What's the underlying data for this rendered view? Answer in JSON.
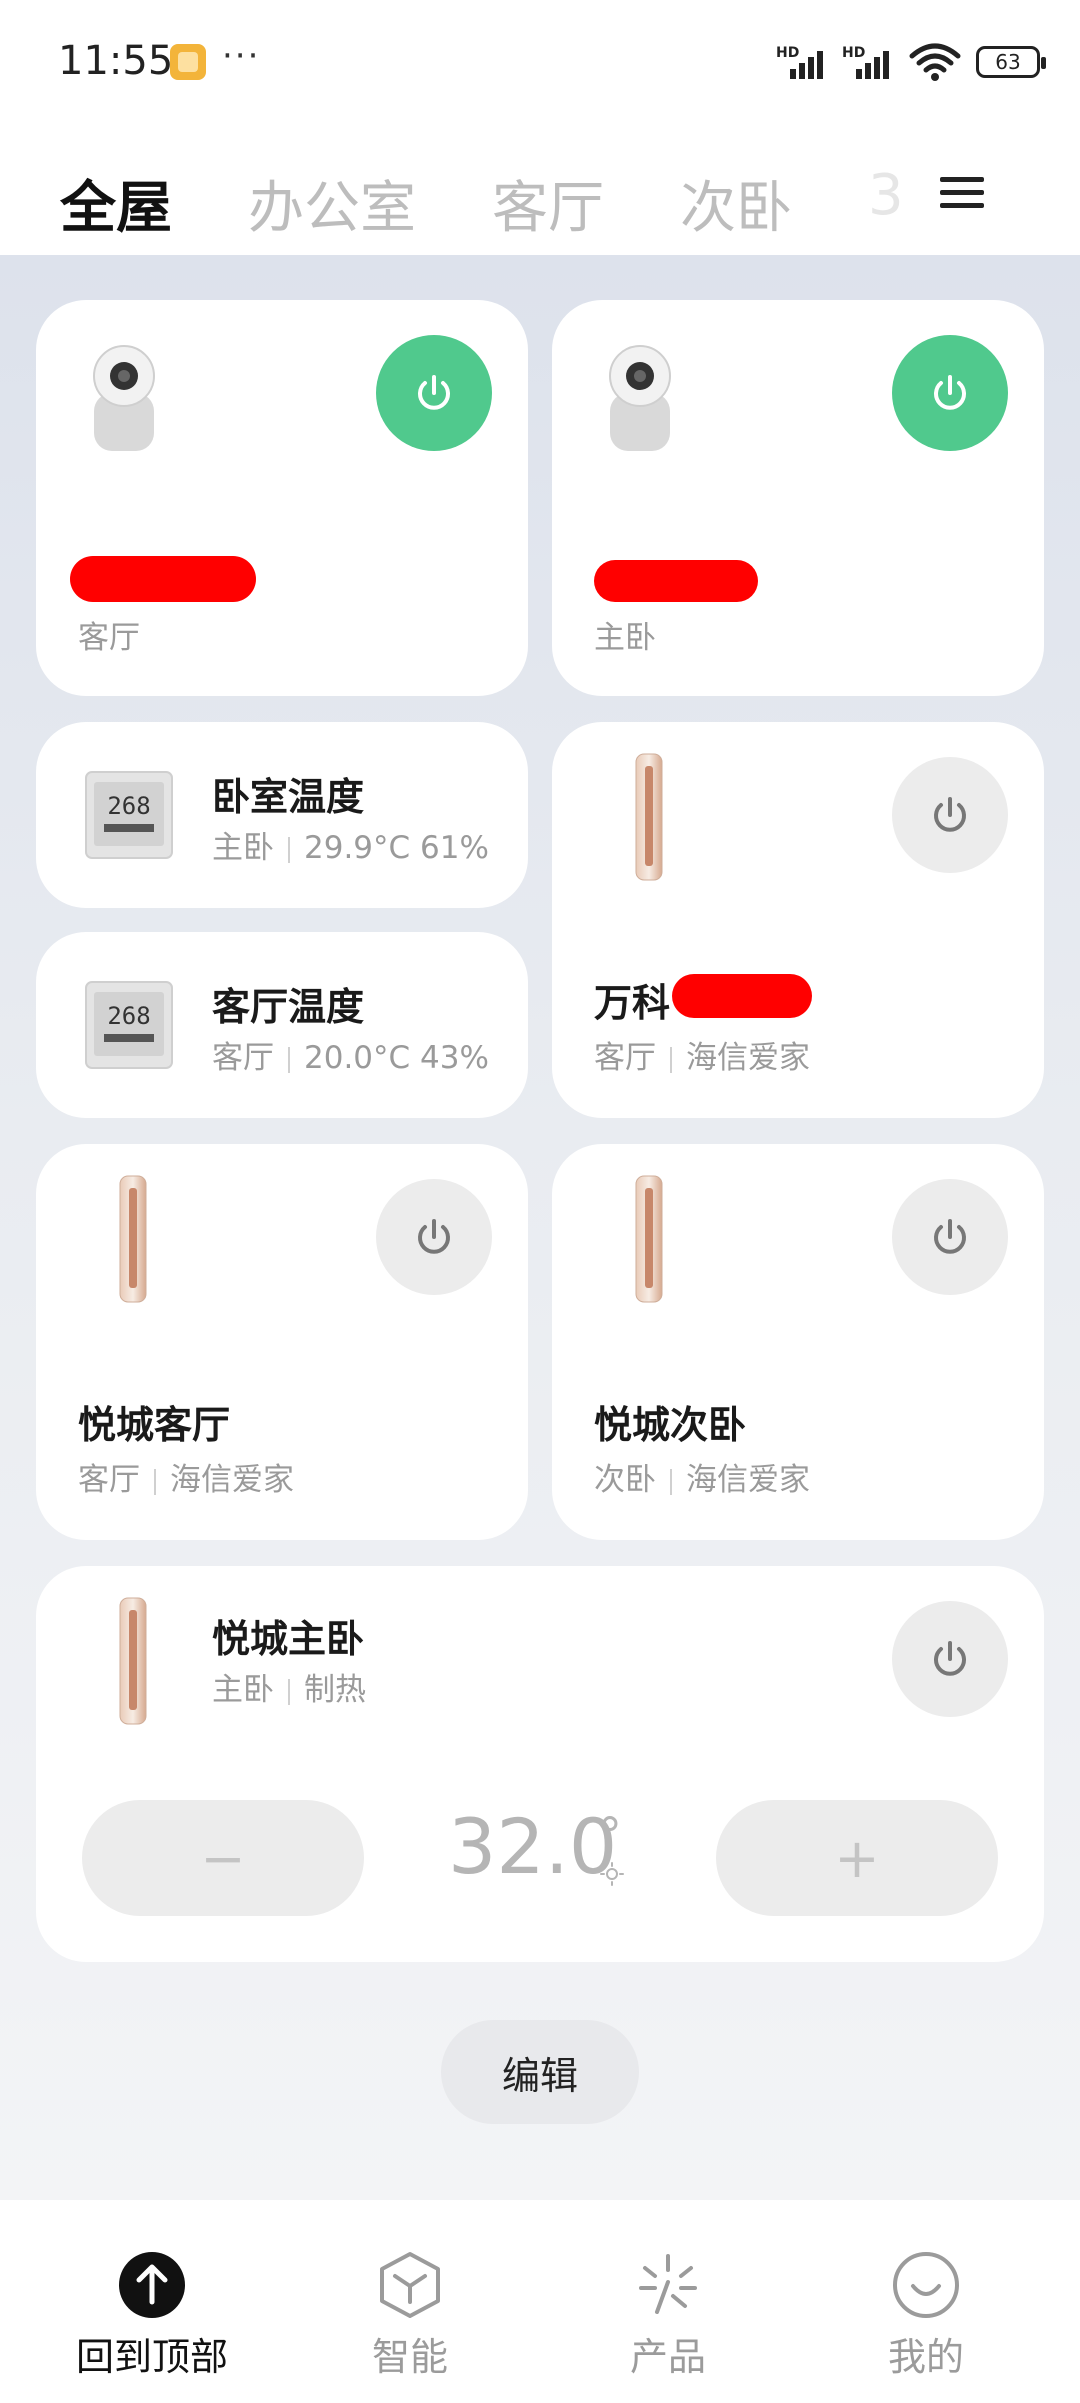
{
  "status_bar": {
    "time": "11:55",
    "more": "···",
    "signal1_badge": "HD",
    "signal2_badge": "HD",
    "battery": "63"
  },
  "tabs": [
    {
      "label": "全屋",
      "active": true
    },
    {
      "label": "办公室"
    },
    {
      "label": "客厅"
    },
    {
      "label": "次卧"
    },
    {
      "label": "3"
    }
  ],
  "cards": {
    "camera1": {
      "room": "客厅",
      "power": "on"
    },
    "camera2": {
      "room": "主卧",
      "power": "on"
    },
    "sensor1": {
      "name": "卧室温度",
      "room": "主卧",
      "reading": "29.9°C 61%",
      "display": "268"
    },
    "sensor2": {
      "name": "客厅温度",
      "room": "客厅",
      "reading": "20.0°C 43%",
      "display": "268"
    },
    "ac_vanke": {
      "name": "万科",
      "room": "客厅",
      "brand": "海信爱家"
    },
    "ac_living": {
      "name": "悦城客厅",
      "room": "客厅",
      "brand": "海信爱家"
    },
    "ac_second": {
      "name": "悦城次卧",
      "room": "次卧",
      "brand": "海信爱家"
    },
    "ac_master": {
      "name": "悦城主卧",
      "room": "主卧",
      "mode": "制热",
      "temperature": "32.0",
      "unit": "°",
      "minus": "−",
      "plus": "+"
    }
  },
  "edit_label": "编辑",
  "bottom_nav": [
    {
      "label": "回到顶部",
      "icon": "arrow-up-icon",
      "active": true
    },
    {
      "label": "智能",
      "icon": "cube-icon"
    },
    {
      "label": "产品",
      "icon": "sparkle-icon"
    },
    {
      "label": "我的",
      "icon": "smile-icon"
    }
  ],
  "colors": {
    "power_on": "#50c98d",
    "redaction": "#ff0000"
  }
}
